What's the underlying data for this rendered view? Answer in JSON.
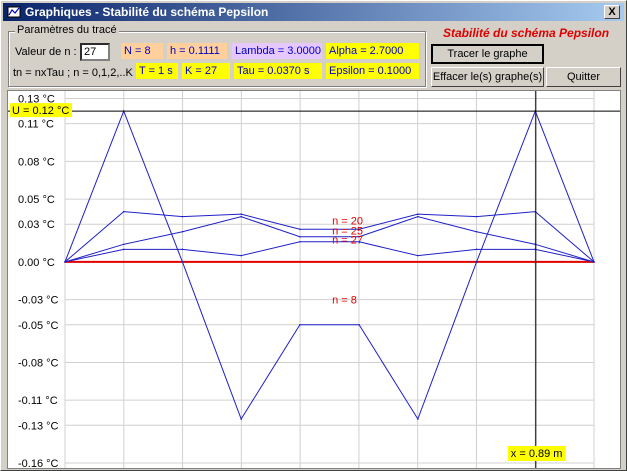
{
  "window": {
    "title": "Graphiques - Stabilité du schéma Pepsilon",
    "close_label": "X"
  },
  "params": {
    "group_label": "Paramètres du tracé",
    "value_label": "Valeur de n :",
    "value_input": "27",
    "tn_label": "tn = nxTau ; n = 0,1,2,..K",
    "row1": [
      "N = 8",
      "h = 0.1111",
      "Lambda = 3.0000",
      "Alpha = 2.7000"
    ],
    "row2": [
      "T = 1 s",
      "K = 27",
      "Tau = 0.0370 s",
      "Epsilon = 0.1000"
    ]
  },
  "header_title": "Stabilité du schéma Pepsilon",
  "buttons": {
    "trace": "Tracer le graphe",
    "clear": "Effacer le(s) graphe(s)",
    "quit": "Quitter"
  },
  "readouts": {
    "u_value": "U = 0.12 °C",
    "x_value": "x = 0.89 m"
  },
  "colors": {
    "curve": "#1f1fc8",
    "zero_line": "#e00000",
    "label_red": "#e00000",
    "highlight": "#ffff00"
  },
  "chart_data": {
    "type": "line",
    "x": [
      0,
      0.111,
      0.222,
      0.333,
      0.444,
      0.556,
      0.667,
      0.778,
      0.889,
      1.0
    ],
    "xlim": [
      0,
      1.0
    ],
    "ylim": [
      -0.16,
      0.136
    ],
    "yticks": [
      0.13,
      0.11,
      0.08,
      0.05,
      0.03,
      0.0,
      -0.03,
      -0.05,
      -0.08,
      -0.11,
      -0.13,
      -0.16
    ],
    "ytick_labels": [
      "0.13 °C",
      "0.11 °C",
      "0.08 °C",
      "0.05 °C",
      "0.03 °C",
      "0.00 °C",
      "-0.03 °C",
      "-0.05 °C",
      "-0.08 °C",
      "-0.11 °C",
      "-0.13 °C",
      "-0.16 °C"
    ],
    "grid": true,
    "cursor": {
      "x": 0.89,
      "y": 0.12
    },
    "series": [
      {
        "name": "n = 8",
        "values": [
          0,
          0.12,
          0.0,
          -0.125,
          -0.05,
          -0.05,
          -0.125,
          0.0,
          0.12,
          0
        ]
      },
      {
        "name": "n = 20",
        "values": [
          0,
          0.04,
          0.036,
          0.038,
          0.026,
          0.026,
          0.038,
          0.036,
          0.04,
          0
        ]
      },
      {
        "name": "n = 25",
        "values": [
          0,
          0.014,
          0.024,
          0.036,
          0.02,
          0.02,
          0.036,
          0.024,
          0.014,
          0
        ]
      },
      {
        "name": "n = 27",
        "values": [
          0,
          0.01,
          0.01,
          0.005,
          0.016,
          0.016,
          0.005,
          0.01,
          0.01,
          0
        ]
      }
    ],
    "label_positions": [
      {
        "name": "n = 20",
        "x": 0.52,
        "y": 0.033
      },
      {
        "name": "n = 25",
        "x": 0.52,
        "y": 0.025
      },
      {
        "name": "n = 27",
        "x": 0.52,
        "y": 0.018
      },
      {
        "name": "n = 8",
        "x": 0.52,
        "y": -0.03
      }
    ]
  }
}
